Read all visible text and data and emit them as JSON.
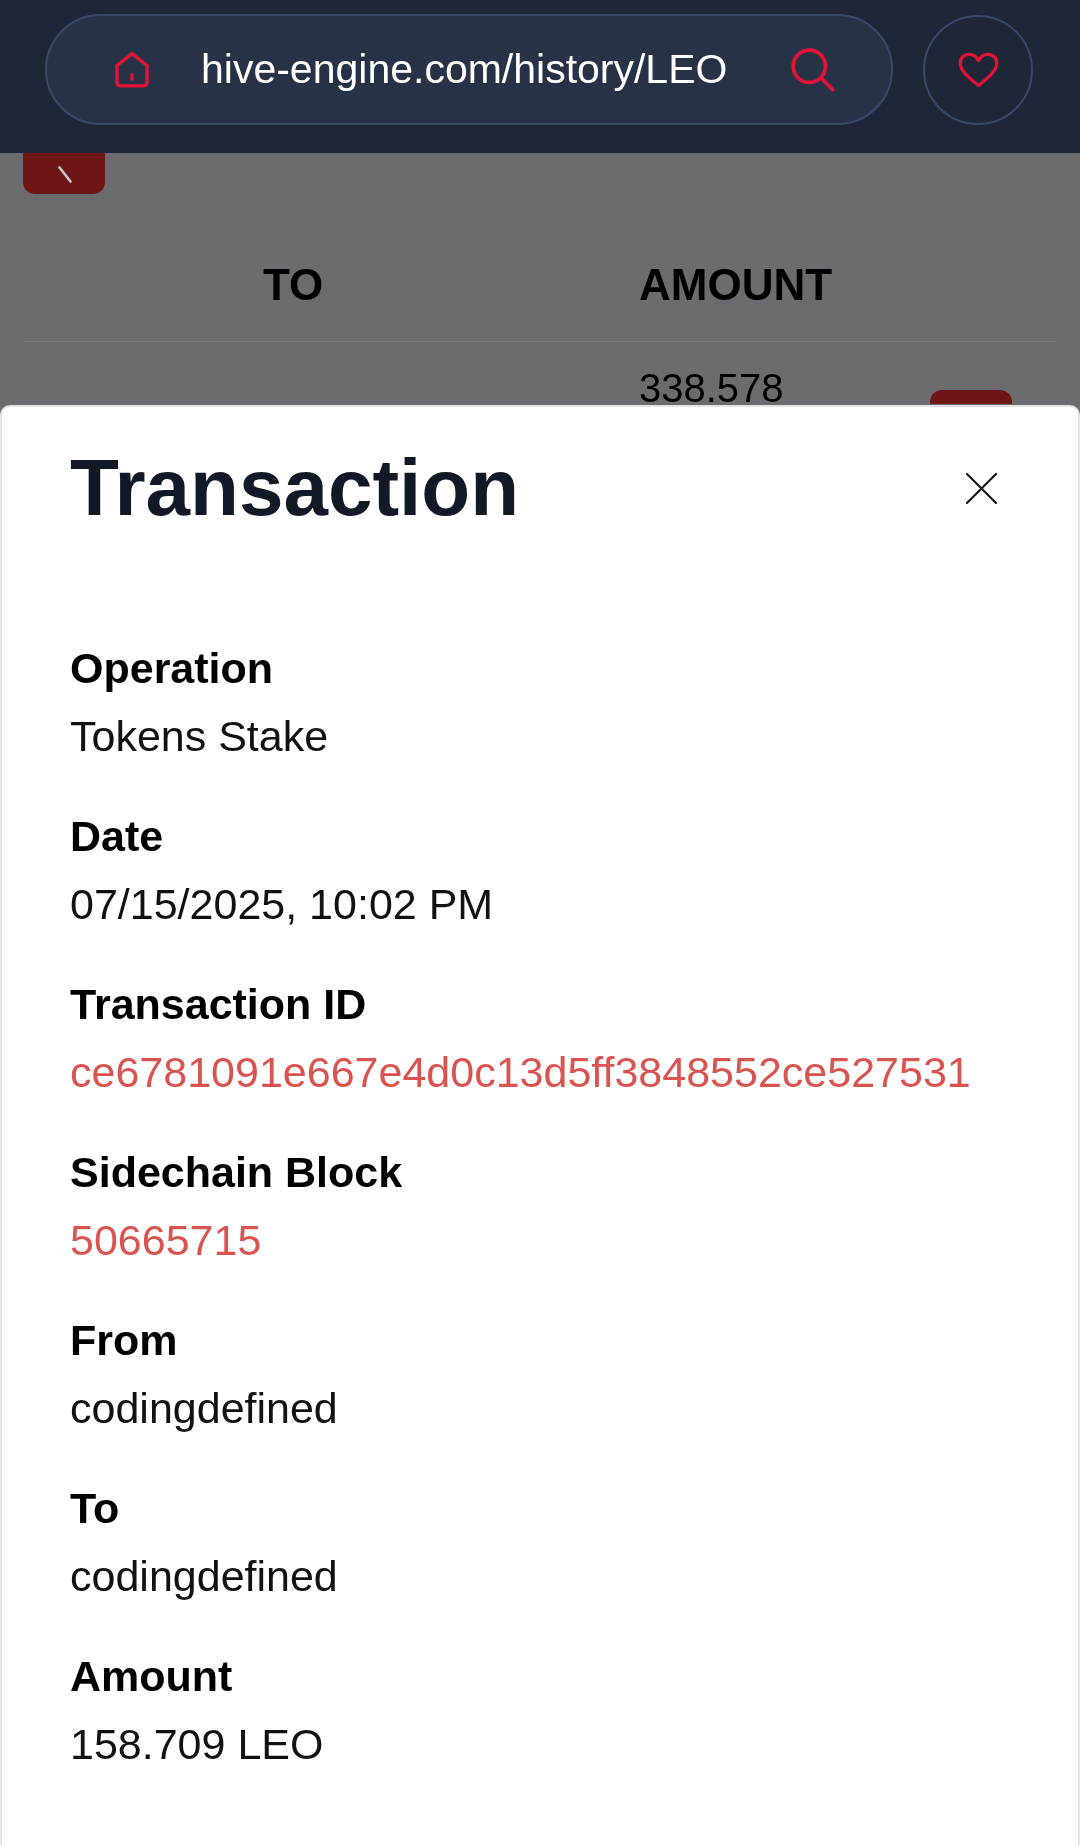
{
  "address_bar": {
    "url": "hive-engine.com/history/LEO"
  },
  "background_table": {
    "columns": [
      "TO",
      "AMOUNT"
    ],
    "rows": [
      {
        "amount": "338.578"
      }
    ]
  },
  "modal": {
    "title": "Transaction",
    "fields": [
      {
        "label": "Operation",
        "value": "Tokens Stake",
        "kind": "text"
      },
      {
        "label": "Date",
        "value": "07/15/2025, 10:02 PM",
        "kind": "text"
      },
      {
        "label": "Transaction ID",
        "value": "ce6781091e667e4d0c13d5ff3848552ce527531",
        "kind": "link"
      },
      {
        "label": "Sidechain Block",
        "value": "50665715",
        "kind": "link"
      },
      {
        "label": "From",
        "value": "codingdefined",
        "kind": "text"
      },
      {
        "label": "To",
        "value": "codingdefined",
        "kind": "text"
      },
      {
        "label": "Amount",
        "value": "158.709 LEO",
        "kind": "text"
      }
    ]
  }
}
